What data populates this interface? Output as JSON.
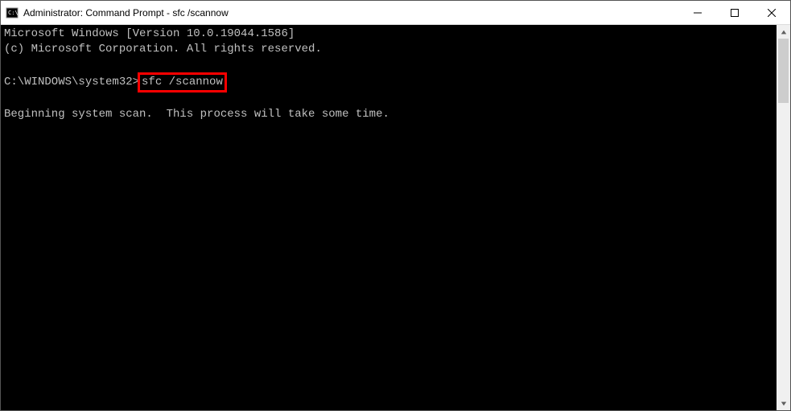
{
  "titlebar": {
    "title": "Administrator: Command Prompt - sfc  /scannow"
  },
  "terminal": {
    "line1": "Microsoft Windows [Version 10.0.19044.1586]",
    "line2": "(c) Microsoft Corporation. All rights reserved.",
    "line3_prompt": "C:\\WINDOWS\\system32>",
    "line3_command": "sfc /scannow",
    "line4": "Beginning system scan.  This process will take some time."
  }
}
